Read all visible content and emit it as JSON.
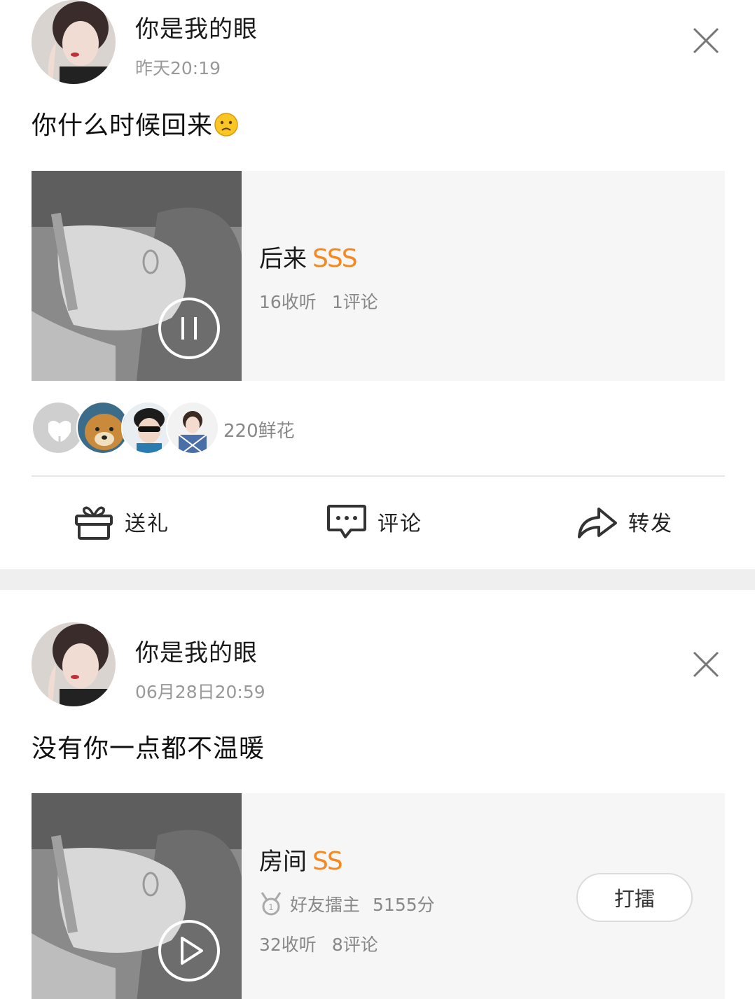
{
  "posts": [
    {
      "username": "你是我的眼",
      "time": "昨天20:19",
      "text": "你什么时候回来",
      "emoji": "sad-face-emoji",
      "song": {
        "title": "后来",
        "badge": "SSS",
        "listens": "16收听",
        "comments": "1评论",
        "state": "playing"
      },
      "flowers": "220鲜花",
      "actions": {
        "gift": "送礼",
        "comment": "评论",
        "forward": "转发"
      }
    },
    {
      "username": "你是我的眼",
      "time": "06月28日20:59",
      "text": "没有你一点都不温暖",
      "song": {
        "title": "房间",
        "badge": "SS",
        "host_label": "好友擂主",
        "host_score": "5155分",
        "listens": "32收听",
        "comments": "8评论",
        "action_button": "打擂",
        "state": "paused"
      }
    }
  ],
  "colors": {
    "badge": "#f5891f",
    "accent_line": "#e53935",
    "muted_text": "#888888",
    "card_bg": "#f6f6f6"
  }
}
